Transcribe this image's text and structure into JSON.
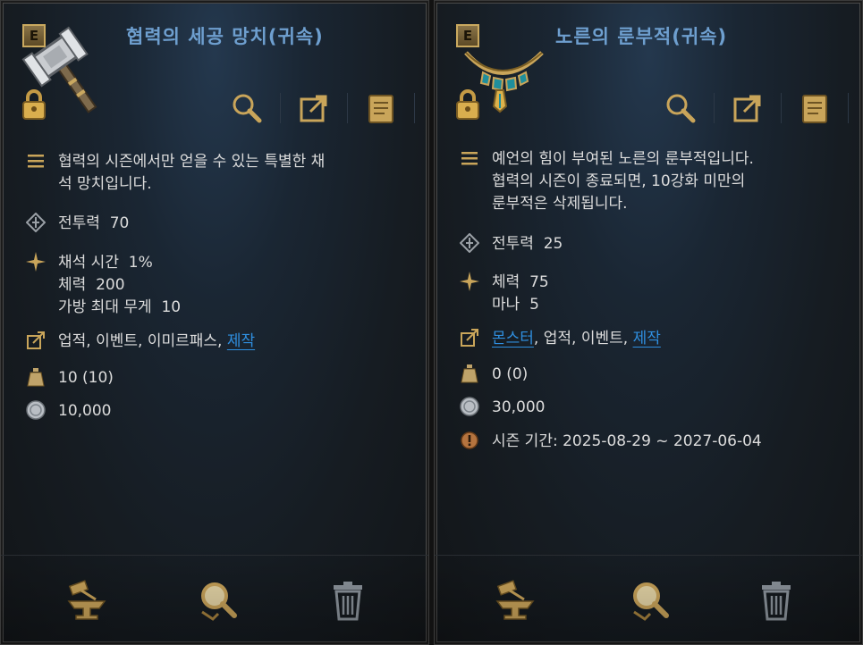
{
  "panels": [
    {
      "grade": "E",
      "name": "협력의 세공 망치(귀속)",
      "description_line1": "협력의 시즌에서만 얻을 수 있는 특별한 채",
      "description_line2": "석 망치입니다.",
      "combat_label": "전투력",
      "combat_value": "70",
      "stats": [
        {
          "label": "채석 시간",
          "value": "1%"
        },
        {
          "label": "체력",
          "value": "200"
        },
        {
          "label": "가방 최대 무게",
          "value": "10"
        }
      ],
      "sources": [
        "업적,",
        "이벤트,",
        "이미르패스,"
      ],
      "source_link": "제작",
      "weight": "10 (10)",
      "price": "10,000"
    },
    {
      "grade": "E",
      "name": "노른의 룬부적(귀속)",
      "description_line1": "예언의 힘이 부여된 노른의 룬부적입니다.",
      "description_line2": "협력의 시즌이 종료되면, 10강화 미만의",
      "description_line3": "룬부적은 삭제됩니다.",
      "combat_label": "전투력",
      "combat_value": "25",
      "stats": [
        {
          "label": "체력",
          "value": "75"
        },
        {
          "label": "마나",
          "value": "5"
        }
      ],
      "source_link_first": "몬스터",
      "sources": [
        "업적,",
        "이벤트,"
      ],
      "source_link": "제작",
      "weight": "0 (0)",
      "price": "30,000",
      "season_period": "시즌 기간: 2025-08-29 ~ 2027-06-04"
    }
  ],
  "colors": {
    "title": "#6e9fcf",
    "link": "#2f8fe0",
    "season": "#d7a92a"
  }
}
